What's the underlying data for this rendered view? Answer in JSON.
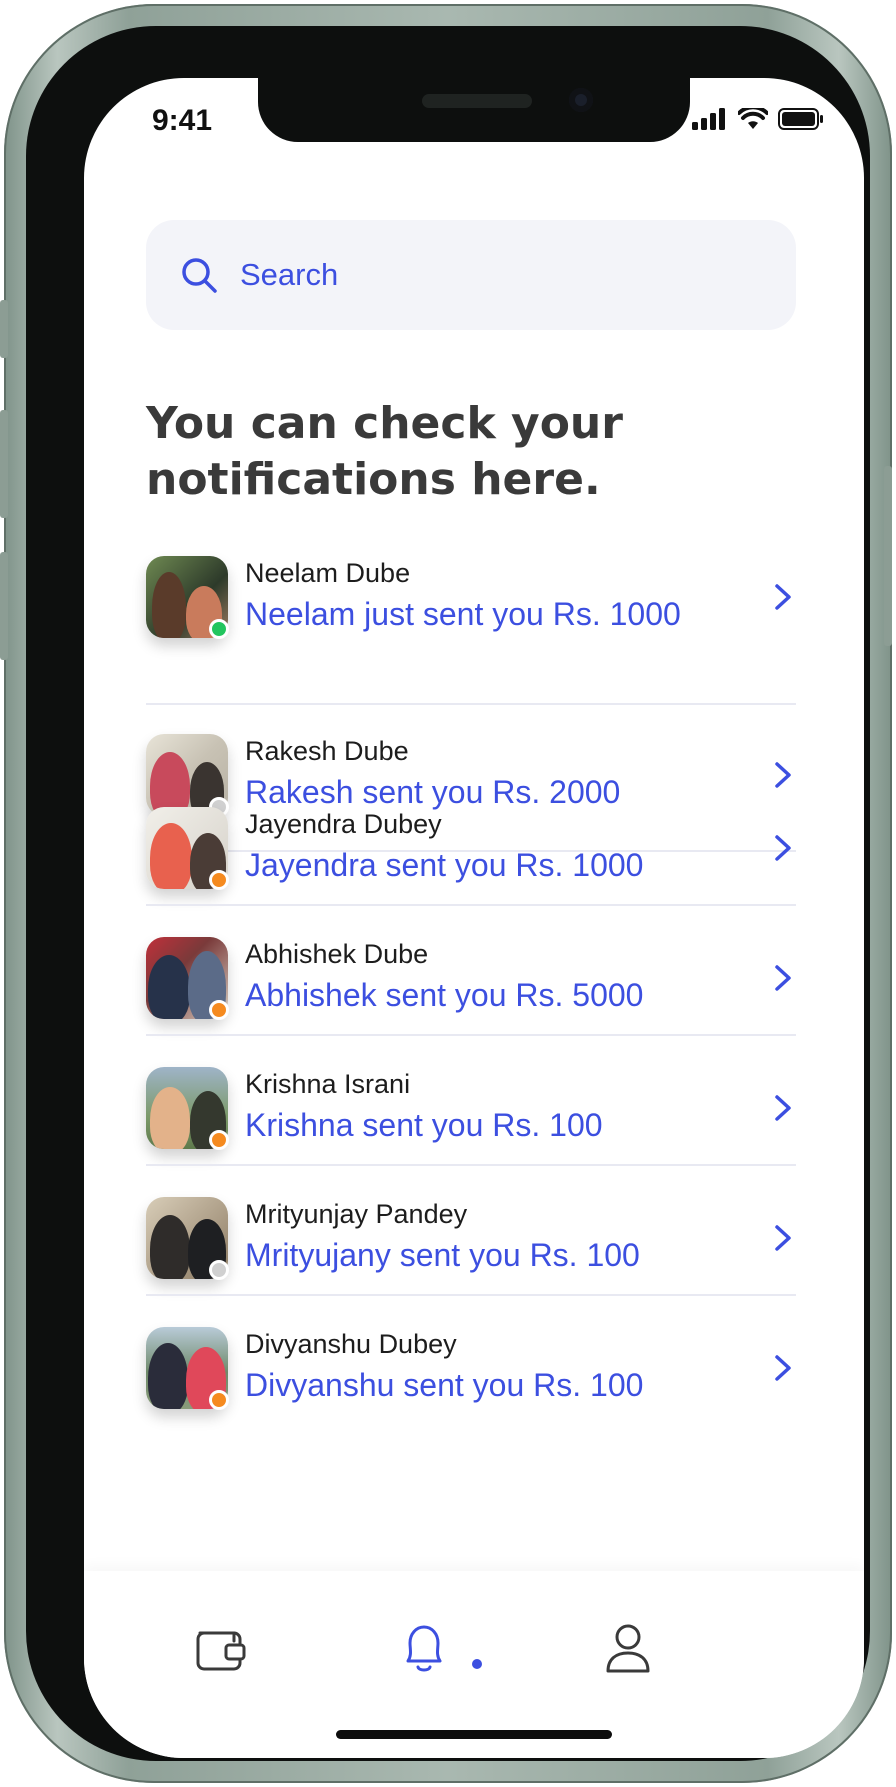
{
  "status_bar": {
    "time": "9:41"
  },
  "search": {
    "placeholder": "Search"
  },
  "heading": "You can check your notifications here.",
  "notifications": [
    {
      "name": "Neelam Dube",
      "message": "Neelam just sent you Rs. 1000",
      "status": "online"
    },
    {
      "name": "Rakesh Dube",
      "message": "Rakesh sent you Rs. 2000",
      "status": "offline"
    },
    {
      "name": "Jayendra Dubey",
      "message": "Jayendra sent you Rs. 1000",
      "status": "away"
    },
    {
      "name": "Abhishek Dube",
      "message": "Abhishek sent you Rs. 5000",
      "status": "away"
    },
    {
      "name": "Krishna Israni",
      "message": "Krishna sent you Rs. 100",
      "status": "away"
    },
    {
      "name": "Mrityunjay Pandey",
      "message": "Mrityujany sent you Rs. 100",
      "status": "offline"
    },
    {
      "name": "Divyanshu Dubey",
      "message": "Divyanshu sent you Rs. 100",
      "status": "away"
    }
  ],
  "tabs": [
    {
      "icon": "wallet-icon",
      "active": false
    },
    {
      "icon": "bell-icon",
      "active": true
    },
    {
      "icon": "user-icon",
      "active": false
    }
  ],
  "colors": {
    "accent": "#3c4fe0",
    "online": "#22c55e",
    "offline": "#d0d0d0",
    "away": "#f58a1f"
  }
}
